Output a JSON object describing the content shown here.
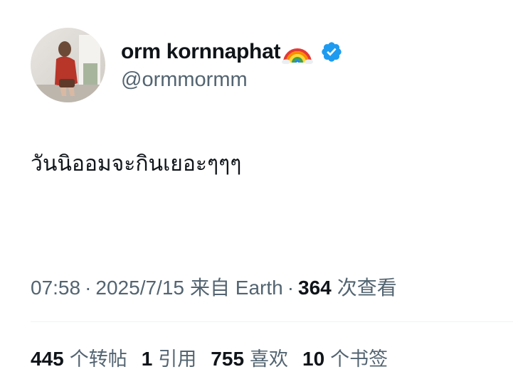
{
  "profile": {
    "display_name": "orm kornnaphat",
    "handle": "@ormmormm",
    "verified_color": "#1d9bf0",
    "name_emoji_icon": "rainbow-icon",
    "verified_icon": "verified-badge-icon"
  },
  "tweet": {
    "text": "วันนิออมจะกินเยอะๆๆๆ"
  },
  "meta": {
    "time": "07:58",
    "separator": "·",
    "date": "2025/7/15",
    "source": "来自 Earth",
    "views_count": "364",
    "views_label": "次查看"
  },
  "stats": [
    {
      "count": "445",
      "label": "个转帖"
    },
    {
      "count": "1",
      "label": "引用"
    },
    {
      "count": "755",
      "label": "喜欢"
    },
    {
      "count": "10",
      "label": "个书签"
    }
  ],
  "colors": {
    "text_primary": "#0f1419",
    "text_secondary": "#536471",
    "divider": "#eff3f4"
  }
}
